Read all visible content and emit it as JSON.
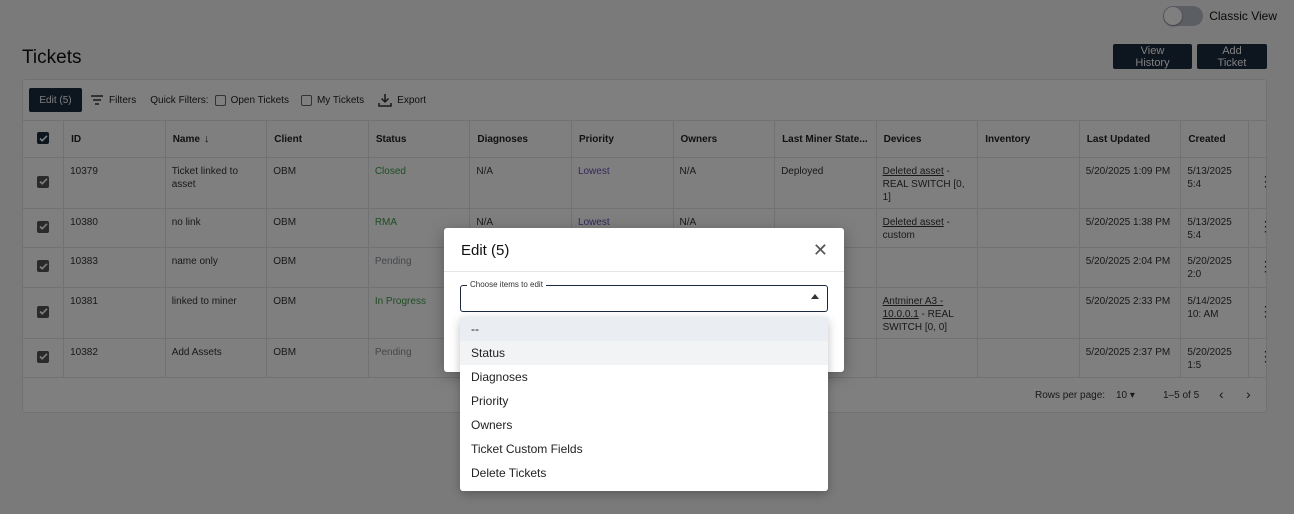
{
  "classic_view": {
    "label": "Classic View"
  },
  "page": {
    "title": "Tickets"
  },
  "header_buttons": {
    "view_history": "View History",
    "add_ticket": "Add Ticket"
  },
  "toolbar": {
    "edit": "Edit (5)",
    "filters": "Filters",
    "quick_filters": "Quick Filters:",
    "open_tickets": "Open Tickets",
    "my_tickets": "My Tickets",
    "export": "Export"
  },
  "table": {
    "columns": [
      "ID",
      "Name",
      "Client",
      "Status",
      "Diagnoses",
      "Priority",
      "Owners",
      "Last Miner State...",
      "Devices",
      "Inventory",
      "Last Updated",
      "Created"
    ],
    "rows": [
      {
        "id": "10379",
        "name": "Ticket linked to asset",
        "client": "OBM",
        "status": "Closed",
        "diagnoses": "N/A",
        "priority": "Lowest",
        "owners": "N/A",
        "miner_state": "Deployed",
        "device_link": "Deleted asset",
        "device_rest": " - REAL SWITCH [0, 1]",
        "inventory": "",
        "last_updated": "5/20/2025 1:09 PM",
        "created": "5/13/2025 5:4"
      },
      {
        "id": "10380",
        "name": "no link",
        "client": "OBM",
        "status": "RMA",
        "diagnoses": "N/A",
        "priority": "Lowest",
        "owners": "N/A",
        "miner_state": "",
        "device_link": "Deleted asset",
        "device_rest": " - custom",
        "inventory": "",
        "last_updated": "5/20/2025 1:38 PM",
        "created": "5/13/2025 5:4"
      },
      {
        "id": "10383",
        "name": "name only",
        "client": "OBM",
        "status": "Pending",
        "diagnoses": "",
        "priority": "",
        "owners": "",
        "miner_state": "",
        "device_link": "",
        "device_rest": "",
        "inventory": "",
        "last_updated": "5/20/2025 2:04 PM",
        "created": "5/20/2025 2:0"
      },
      {
        "id": "10381",
        "name": "linked to miner",
        "client": "OBM",
        "status": "In Progress",
        "diagnoses": "",
        "priority": "",
        "owners": "",
        "miner_state": "",
        "device_link": "Antminer A3 - 10.0.0.1",
        "device_rest": " - REAL SWITCH [0, 0]",
        "inventory": "",
        "last_updated": "5/20/2025 2:33 PM",
        "created": "5/14/2025 10: AM"
      },
      {
        "id": "10382",
        "name": "Add Assets",
        "client": "OBM",
        "status": "Pending",
        "diagnoses": "",
        "priority": "",
        "owners": "",
        "miner_state": "",
        "device_link": "",
        "device_rest": "",
        "inventory": "",
        "last_updated": "5/20/2025 2:37 PM",
        "created": "5/20/2025 1:5"
      }
    ]
  },
  "pagination": {
    "rows_per_page_label": "Rows per page:",
    "rows_per_page": "10",
    "range": "1–5 of 5"
  },
  "dialog": {
    "title": "Edit (5)",
    "field_label": "Choose items to edit",
    "options": [
      "--",
      "Status",
      "Diagnoses",
      "Priority",
      "Owners",
      "Ticket Custom Fields",
      "Delete Tickets"
    ]
  },
  "colors": {
    "primary": "#1b2a3c",
    "status_green": "#3f9b47",
    "status_grey": "#8a8f96",
    "priority_purple": "#6b4fb8"
  },
  "icons": {
    "filters": "filter-lines-icon",
    "export": "download-icon",
    "close": "close-icon",
    "row_menu": "kebab-icon",
    "sort": "arrow-down-icon"
  }
}
